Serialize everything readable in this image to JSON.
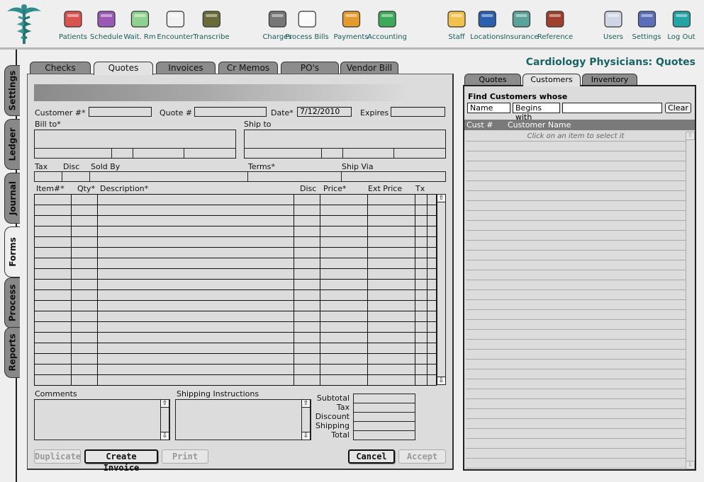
{
  "toolbar": {
    "items": [
      {
        "label": "Patients",
        "icon": "patients-icon"
      },
      {
        "label": "Schedule",
        "icon": "calendar-icon"
      },
      {
        "label": "Wait. Rm",
        "icon": "waiting-room-icon"
      },
      {
        "label": "Encounter",
        "icon": "medical-kit-icon"
      },
      {
        "label": "Transcribe",
        "icon": "cassette-icon"
      },
      {
        "label": "Charges",
        "icon": "calculator-icon"
      },
      {
        "label": "Process Bills",
        "icon": "paper-stack-icon"
      },
      {
        "label": "Payments",
        "icon": "credit-card-icon"
      },
      {
        "label": "Accounting",
        "icon": "money-icon"
      },
      {
        "label": "Staff",
        "icon": "nurse-icon"
      },
      {
        "label": "Locations",
        "icon": "address-book-icon"
      },
      {
        "label": "Insurance",
        "icon": "buildings-icon"
      },
      {
        "label": "Reference",
        "icon": "book-icon"
      },
      {
        "label": "Users",
        "icon": "user-icon"
      },
      {
        "label": "Settings",
        "icon": "file-cabinet-icon"
      },
      {
        "label": "Log Out",
        "icon": "exit-door-icon"
      }
    ]
  },
  "side_tabs": [
    "Settings",
    "Ledger",
    "Journal",
    "Forms",
    "Process",
    "Reports"
  ],
  "side_tabs_active": "Forms",
  "doc_tabs": [
    "Checks",
    "Quotes",
    "Invoices",
    "Cr Memos",
    "PO's",
    "Vendor Bill"
  ],
  "doc_tabs_active": "Quotes",
  "page_title": "Cardiology Physicians:  Quotes",
  "form": {
    "customer_label": "Customer #*",
    "customer_value": "",
    "quote_label": "Quote #",
    "quote_value": "",
    "date_label": "Date*",
    "date_value": "7/12/2010",
    "expires_label": "Expires",
    "expires_value": "",
    "bill_to_label": "Bill to*",
    "ship_to_label": "Ship to",
    "tax_label": "Tax",
    "disc_label": "Disc",
    "sold_by_label": "Sold By",
    "terms_label": "Terms*",
    "ship_via_label": "Ship Via",
    "items_columns": [
      "Item#*",
      "Qty*",
      "Description*",
      "Disc",
      "Price*",
      "Ext Price",
      "Tx"
    ],
    "items_row_count": 18,
    "comments_label": "Comments",
    "shipping_instructions_label": "Shipping Instructions",
    "totals": [
      "Subtotal",
      "Tax",
      "Discount",
      "Shipping",
      "Total"
    ]
  },
  "buttons": {
    "duplicate": "Duplicate",
    "create_invoice": "Create Invoice",
    "print": "Print",
    "cancel": "Cancel",
    "accept": "Accept"
  },
  "right": {
    "tabs": [
      "Quotes",
      "Customers",
      "Inventory"
    ],
    "tabs_active": "Customers",
    "find_label": "Find Customers whose",
    "field_select": "Name",
    "operator_select": "Begins with",
    "search_value": "",
    "clear_label": "Clear",
    "columns": [
      "Cust #",
      "Customer Name"
    ],
    "hint": "Click on an item to select it"
  }
}
